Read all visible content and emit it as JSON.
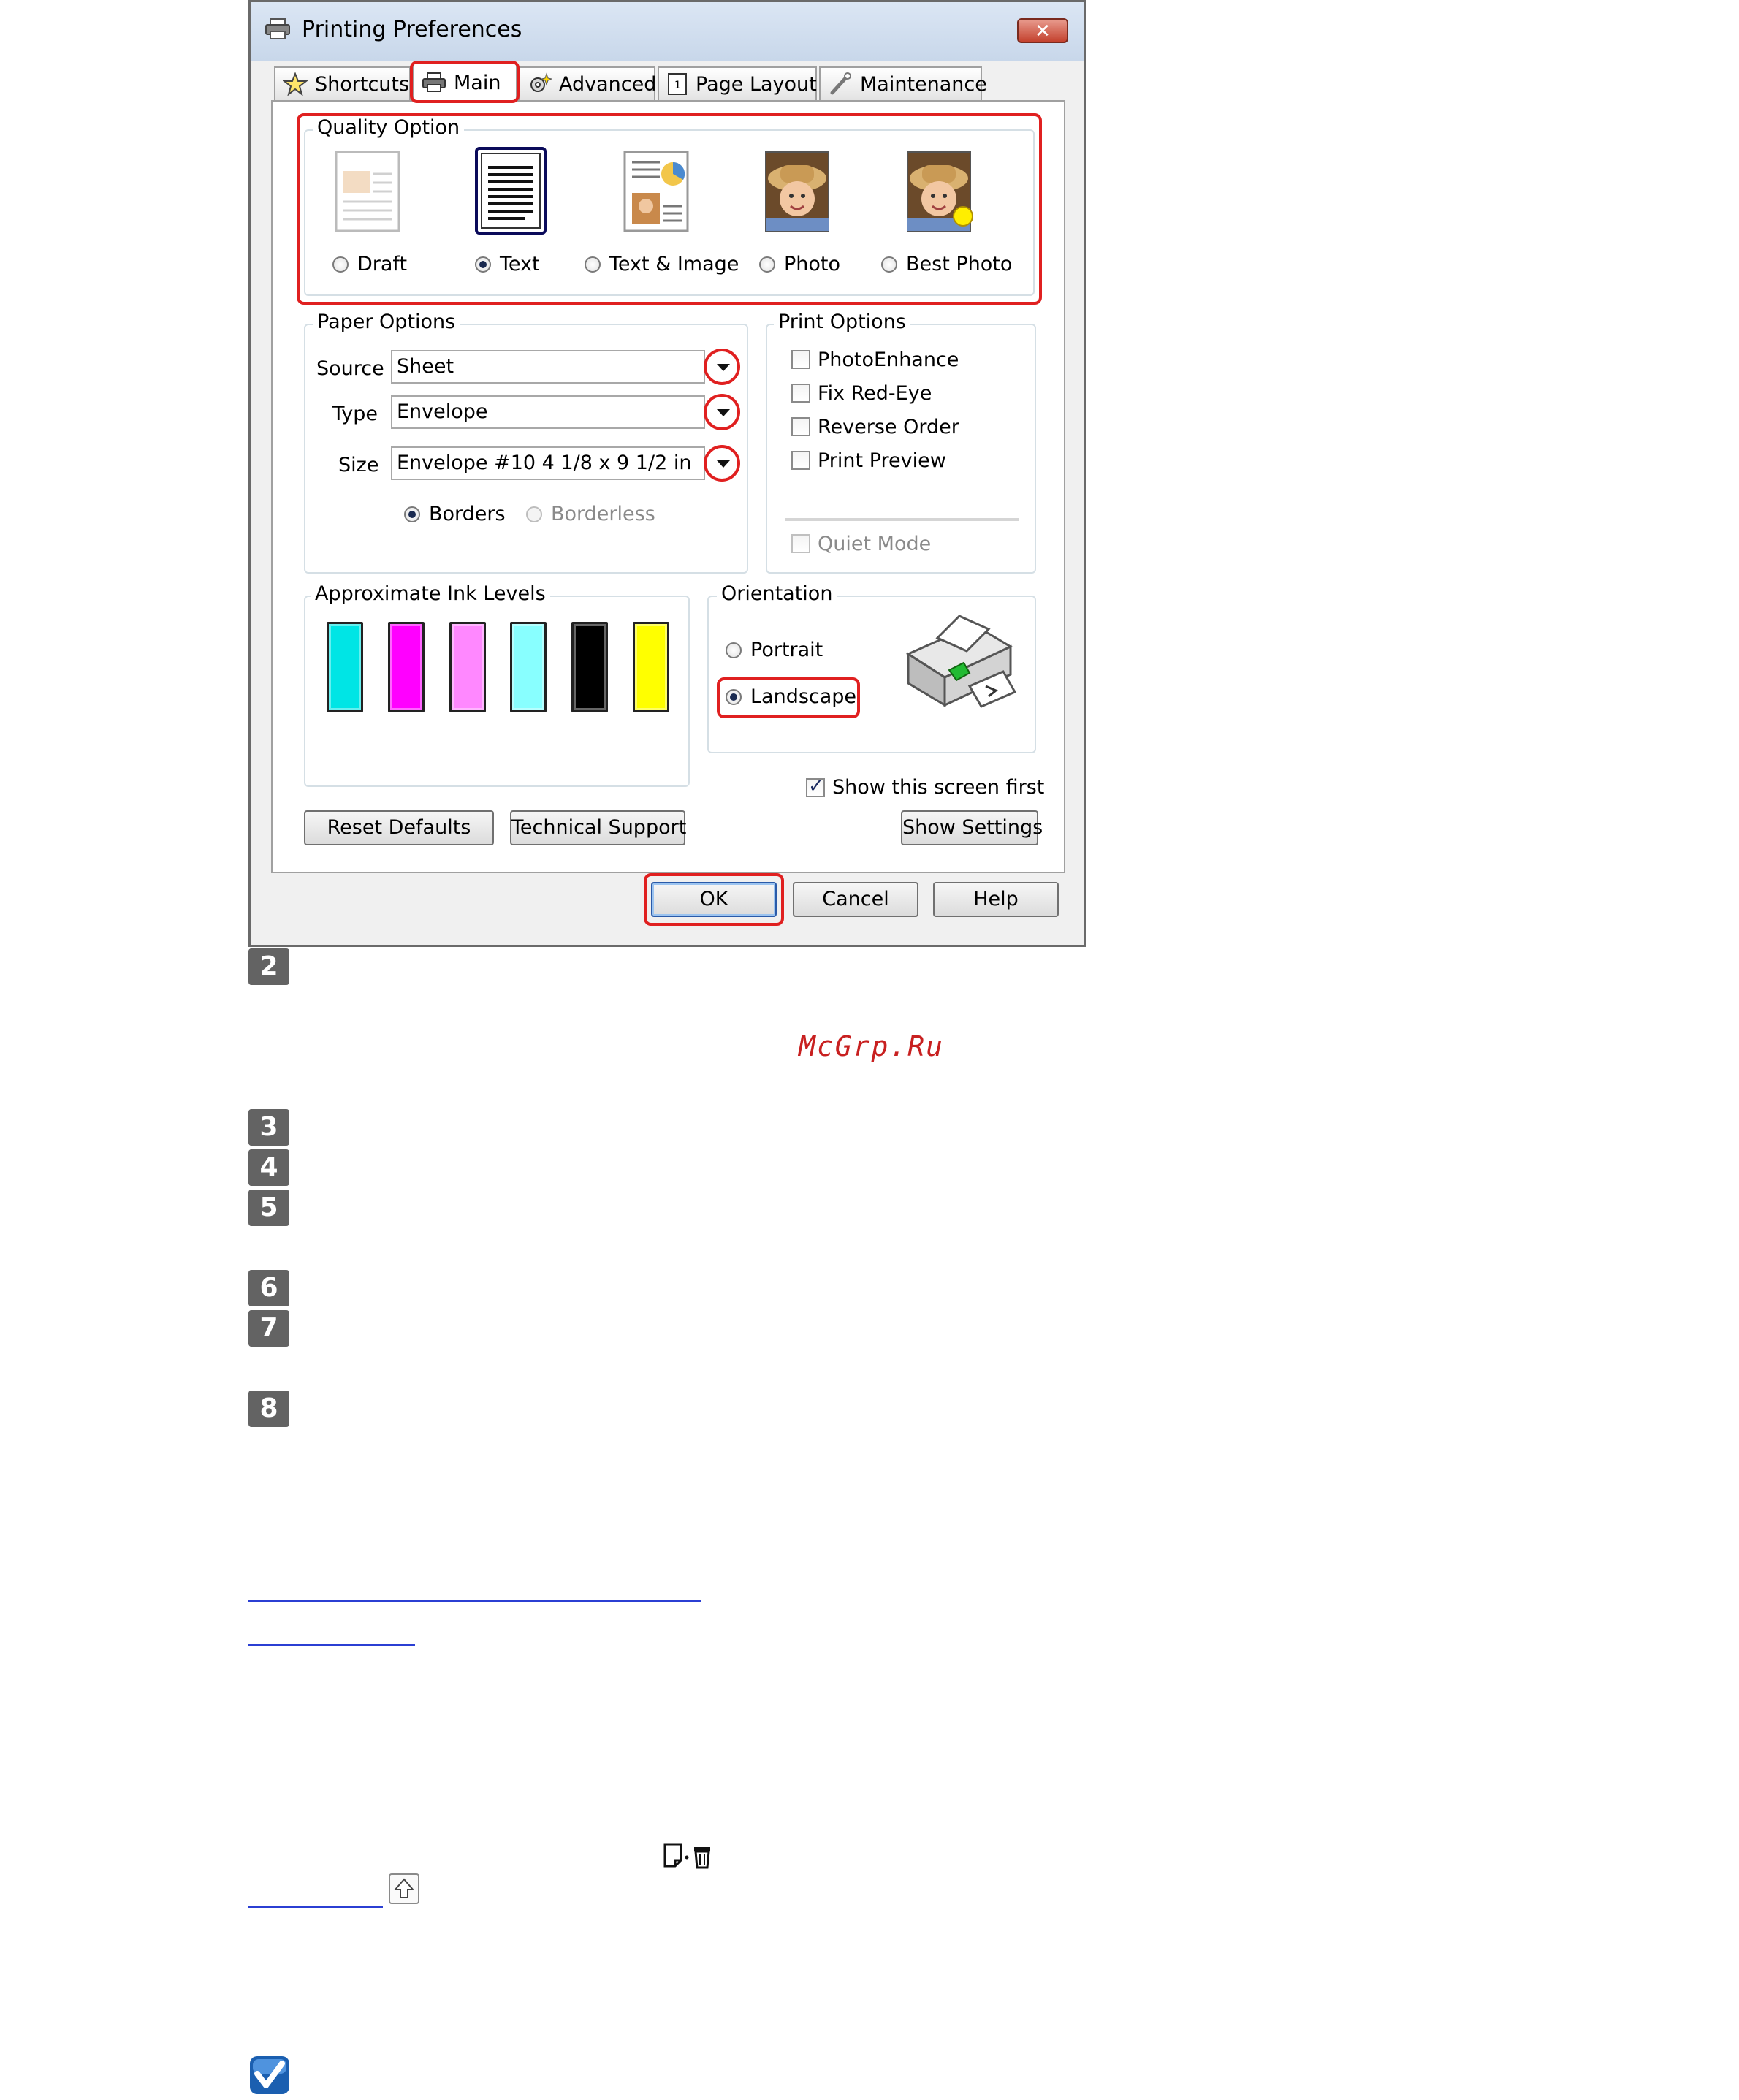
{
  "window": {
    "title": "Printing Preferences",
    "close_label": "✕"
  },
  "tabs": [
    {
      "label": "Shortcuts",
      "icon": "star-icon"
    },
    {
      "label": "Main",
      "icon": "printer-icon",
      "active": true
    },
    {
      "label": "Advanced",
      "icon": "gear-sparkle-icon"
    },
    {
      "label": "Page Layout",
      "icon": "page-layout-icon"
    },
    {
      "label": "Maintenance",
      "icon": "wrench-icon"
    }
  ],
  "quality": {
    "legend": "Quality Option",
    "options": [
      {
        "label": "Draft",
        "selected": false
      },
      {
        "label": "Text",
        "selected": true
      },
      {
        "label": "Text & Image",
        "selected": false
      },
      {
        "label": "Photo",
        "selected": false
      },
      {
        "label": "Best Photo",
        "selected": false
      }
    ]
  },
  "paper": {
    "legend": "Paper Options",
    "source_label": "Source",
    "source_value": "Sheet",
    "type_label": "Type",
    "type_value": "Envelope",
    "size_label": "Size",
    "size_value": "Envelope #10 4 1/8 x 9 1/2 in",
    "borders_label": "Borders",
    "borderless_label": "Borderless"
  },
  "print_options": {
    "legend": "Print Options",
    "photoenhance": "PhotoEnhance",
    "fix_red_eye": "Fix Red-Eye",
    "reverse_order": "Reverse Order",
    "print_preview": "Print Preview",
    "quiet_mode": "Quiet Mode"
  },
  "ink": {
    "legend": "Approximate Ink Levels",
    "colors": [
      "#00e5e5",
      "#ff00ff",
      "#ff88ff",
      "#88ffff",
      "#000000",
      "#ffff00"
    ]
  },
  "orientation": {
    "legend": "Orientation",
    "portrait": "Portrait",
    "landscape": "Landscape",
    "selected": "Landscape"
  },
  "show_first": {
    "label": "Show this screen first",
    "checked": true
  },
  "buttons": {
    "reset": "Reset Defaults",
    "support": "Technical Support",
    "show_settings": "Show Settings",
    "ok": "OK",
    "cancel": "Cancel",
    "help": "Help"
  },
  "steps": [
    "2",
    "3",
    "4",
    "5",
    "6",
    "7",
    "8"
  ],
  "watermark": "McGrp.Ru",
  "colors": {
    "highlight": "#e02020",
    "link": "#2b3fd3",
    "step_badge": "#636363"
  }
}
